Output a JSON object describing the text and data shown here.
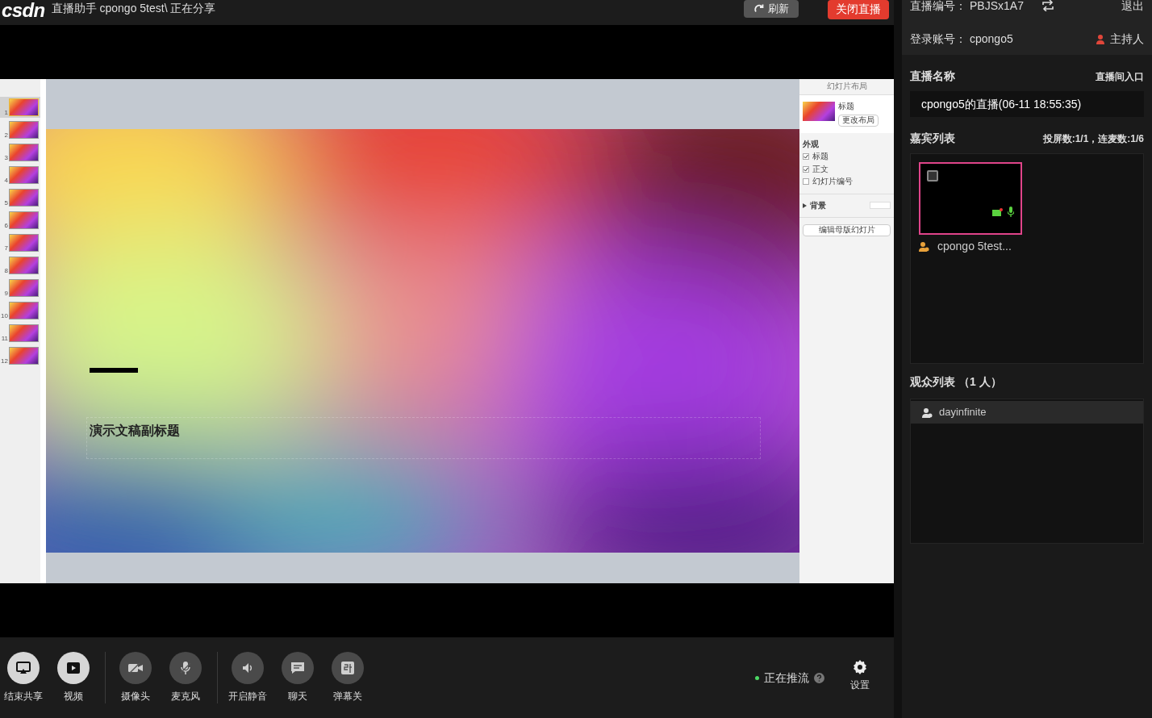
{
  "header": {
    "logo": "csdn",
    "title": "直播助手 cpongo 5test\\ 正在分享",
    "refresh_button": "刷新",
    "close_button": "关闭直播"
  },
  "presentation": {
    "thumbnails": [
      {
        "number": "1",
        "selected": true
      },
      {
        "number": "2",
        "selected": false
      },
      {
        "number": "3",
        "selected": false
      },
      {
        "number": "4",
        "selected": false
      },
      {
        "number": "5",
        "selected": false
      },
      {
        "number": "6",
        "selected": false
      },
      {
        "number": "7",
        "selected": false
      },
      {
        "number": "8",
        "selected": false
      },
      {
        "number": "9",
        "selected": false
      },
      {
        "number": "10",
        "selected": false
      },
      {
        "number": "11",
        "selected": false
      },
      {
        "number": "12",
        "selected": false
      }
    ],
    "slide": {
      "subtitle": "演示文稿副标题"
    },
    "format_pane": {
      "title": "幻灯片布局",
      "layout_label": "标题",
      "change_layout_button": "更改布局",
      "appearance_label": "外观",
      "options": [
        {
          "label": "标题",
          "checked": true
        },
        {
          "label": "正文",
          "checked": true
        },
        {
          "label": "幻灯片编号",
          "checked": false
        }
      ],
      "background_label": "背景",
      "edit_master_button": "编辑母版幻灯片"
    }
  },
  "toolbar": {
    "groups": [
      [
        {
          "label": "结束共享",
          "on": true,
          "kind": "share"
        },
        {
          "label": "视频",
          "on": true,
          "kind": "video"
        }
      ],
      [
        {
          "label": "摄像头",
          "on": false,
          "kind": "camera"
        },
        {
          "label": "麦克风",
          "on": false,
          "kind": "mic"
        }
      ],
      [
        {
          "label": "开启静音",
          "on": false,
          "kind": "speaker"
        },
        {
          "label": "聊天",
          "on": false,
          "kind": "chat"
        },
        {
          "label": "弹幕关",
          "on": false,
          "kind": "danmaku"
        }
      ]
    ],
    "status": "正在推流",
    "settings": "设置"
  },
  "sidebar": {
    "live_id_label": "直播编号：",
    "live_id": "PBJSx1A7",
    "logout": "退出",
    "account_label": "登录账号：",
    "account": "cpongo5",
    "role": "主持人",
    "live_name_label": "直播名称",
    "room_link": "直播间入口",
    "live_name": "cpongo5的直播(06-11 18:55:35)",
    "guests_title": "嘉宾列表",
    "guests_stats": "投屏数:1/1，连麦数:1/6",
    "guests": [
      {
        "name": "cpongo 5test...",
        "selected": true
      }
    ],
    "audience_title": "观众列表 （1 人）",
    "audience": [
      {
        "name": "dayinfinite"
      }
    ]
  }
}
